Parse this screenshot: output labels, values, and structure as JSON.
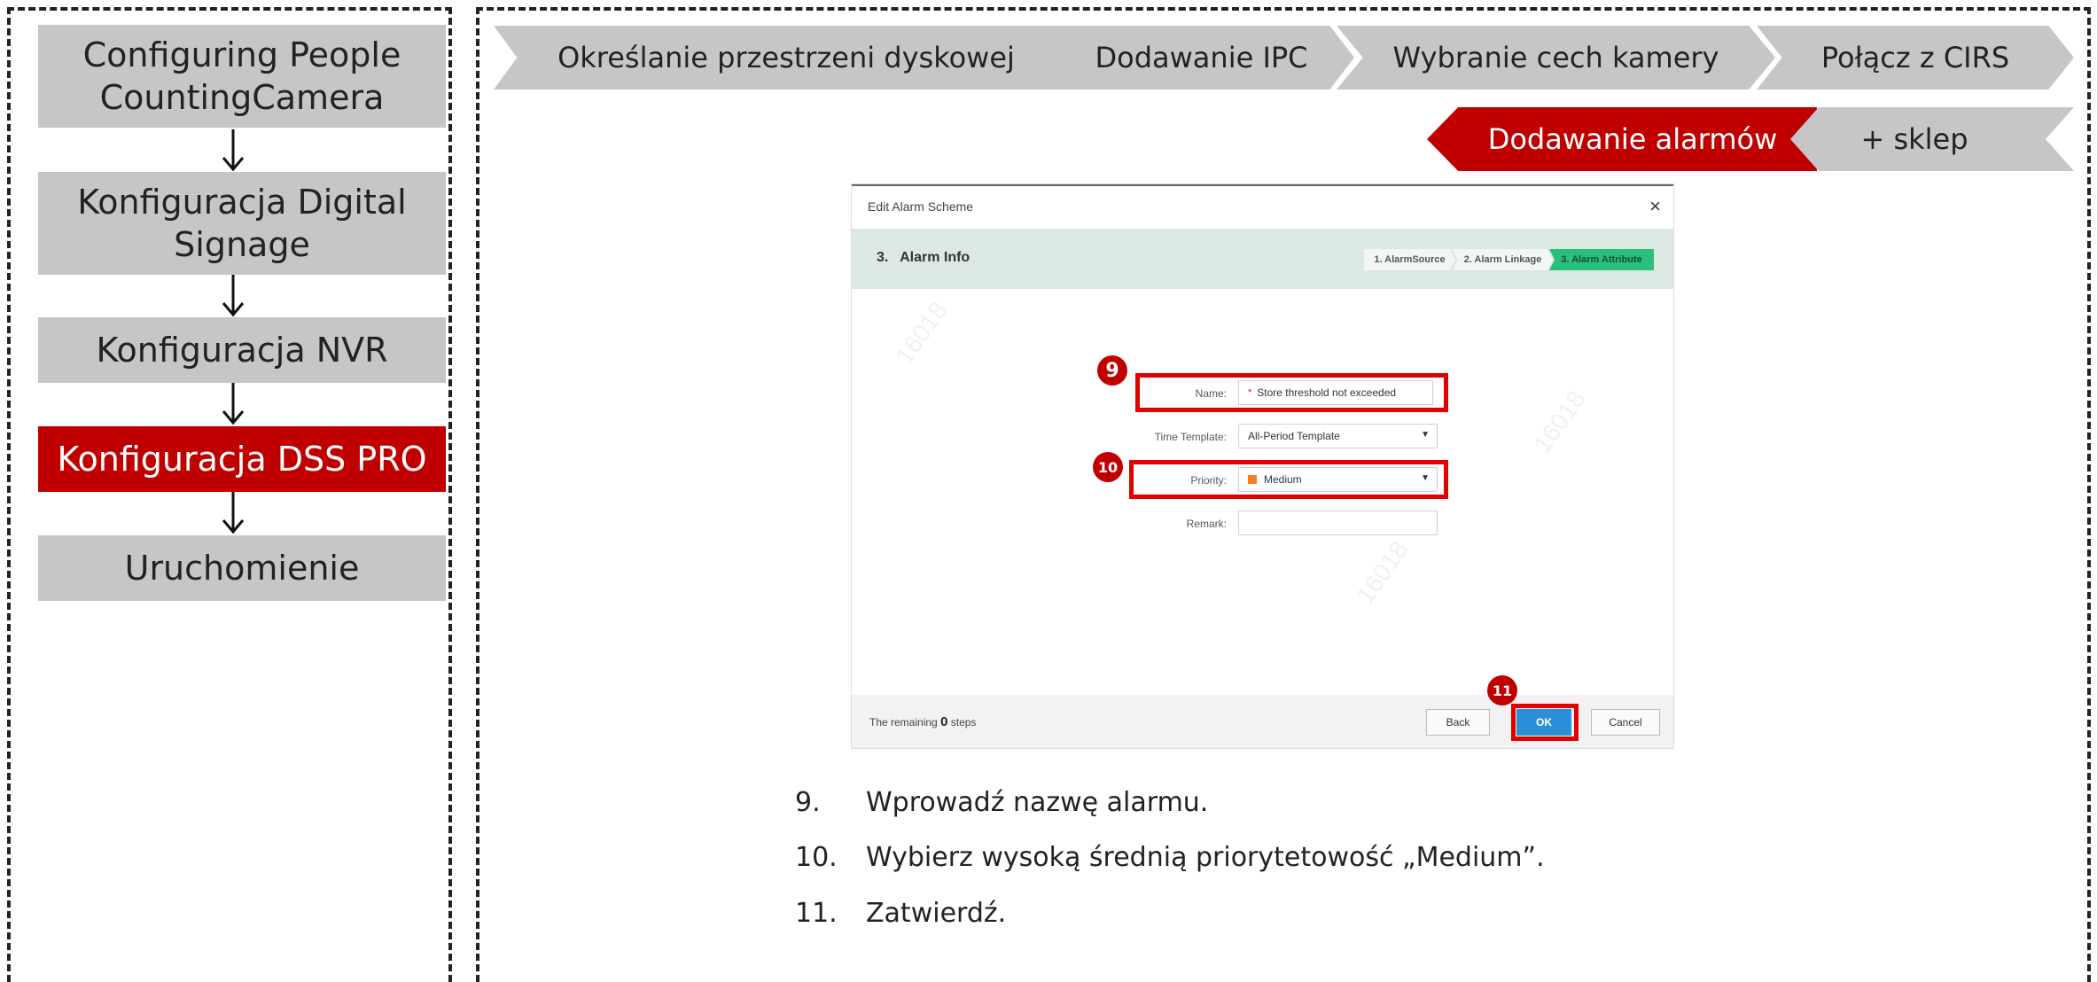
{
  "left_flow": {
    "steps": [
      {
        "label": "Configuring People CountingCamera",
        "active": false
      },
      {
        "label": "Konfiguracja Digital Signage",
        "active": false
      },
      {
        "label": "Konfiguracja NVR",
        "active": false
      },
      {
        "label": "Konfiguracja DSS PRO",
        "active": true
      },
      {
        "label": "Uruchomienie",
        "active": false
      }
    ]
  },
  "top_steps": {
    "row1": [
      "Określanie przestrzeni dyskowej",
      "Dodawanie IPC",
      "Wybranie cech kamery",
      "Połącz z CIRS"
    ],
    "row2": [
      "Dodawanie alarmów",
      "+ sklep"
    ]
  },
  "dialog": {
    "title": "Edit Alarm Scheme",
    "close": "×",
    "step_title": "3.   Alarm Info",
    "wizard": [
      "1. AlarmSource",
      "2. Alarm Linkage",
      "3. Alarm Attribute"
    ],
    "watermark": "16018",
    "fields": {
      "name_label": "Name:",
      "name_required": "*",
      "name_value": "Store threshold not exceeded",
      "time_label": "Time Template:",
      "time_value": "All-Period Template",
      "priority_label": "Priority:",
      "priority_value": "Medium",
      "remark_label": "Remark:",
      "remark_value": ""
    },
    "footer": {
      "remaining_prefix": "The remaining",
      "remaining_count": "0",
      "remaining_suffix": "steps",
      "back": "Back",
      "ok": "OK",
      "cancel": "Cancel"
    },
    "badges": [
      "9",
      "10",
      "11"
    ]
  },
  "instructions": [
    {
      "num": "9.",
      "text": "Wprowadź nazwę alarmu."
    },
    {
      "num": "10.",
      "text": "Wybierz wysoką średnią priorytetowość „Medium”."
    },
    {
      "num": "11.",
      "text": "Zatwierdź."
    }
  ],
  "colors": {
    "accent_red": "#c00000",
    "box_gray": "#c6c6c6",
    "ok_blue": "#2a8fd6",
    "wizard_green": "#29c07c"
  }
}
